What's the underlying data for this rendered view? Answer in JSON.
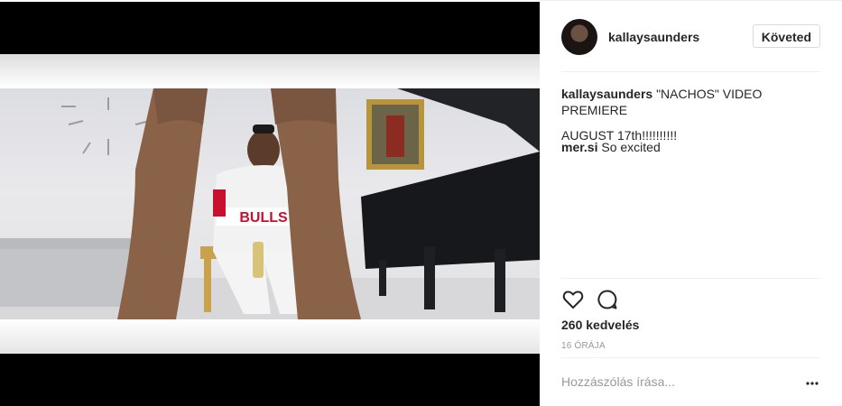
{
  "post": {
    "username": "kallaysaunders",
    "follow_label": "Követed",
    "caption_author": "kallaysaunders",
    "caption_text": "\"NACHOS\" VIDEO PREMIERE",
    "caption_line2": "AUGUST 17th!!!!!!!!!!",
    "comments": [
      {
        "user": "mer.si",
        "text": "So excited"
      }
    ],
    "likes": "260 kedvelés",
    "time": "16 ÓRÁJA",
    "comment_placeholder": "Hozzászólás írása..."
  },
  "media": {
    "jersey_text": "BULLS"
  },
  "icons": {
    "like": "heart-icon",
    "comment": "comment-icon",
    "more": "more-options-icon"
  },
  "colors": {
    "text": "#262626",
    "muted": "#999999",
    "border": "#efefef"
  }
}
